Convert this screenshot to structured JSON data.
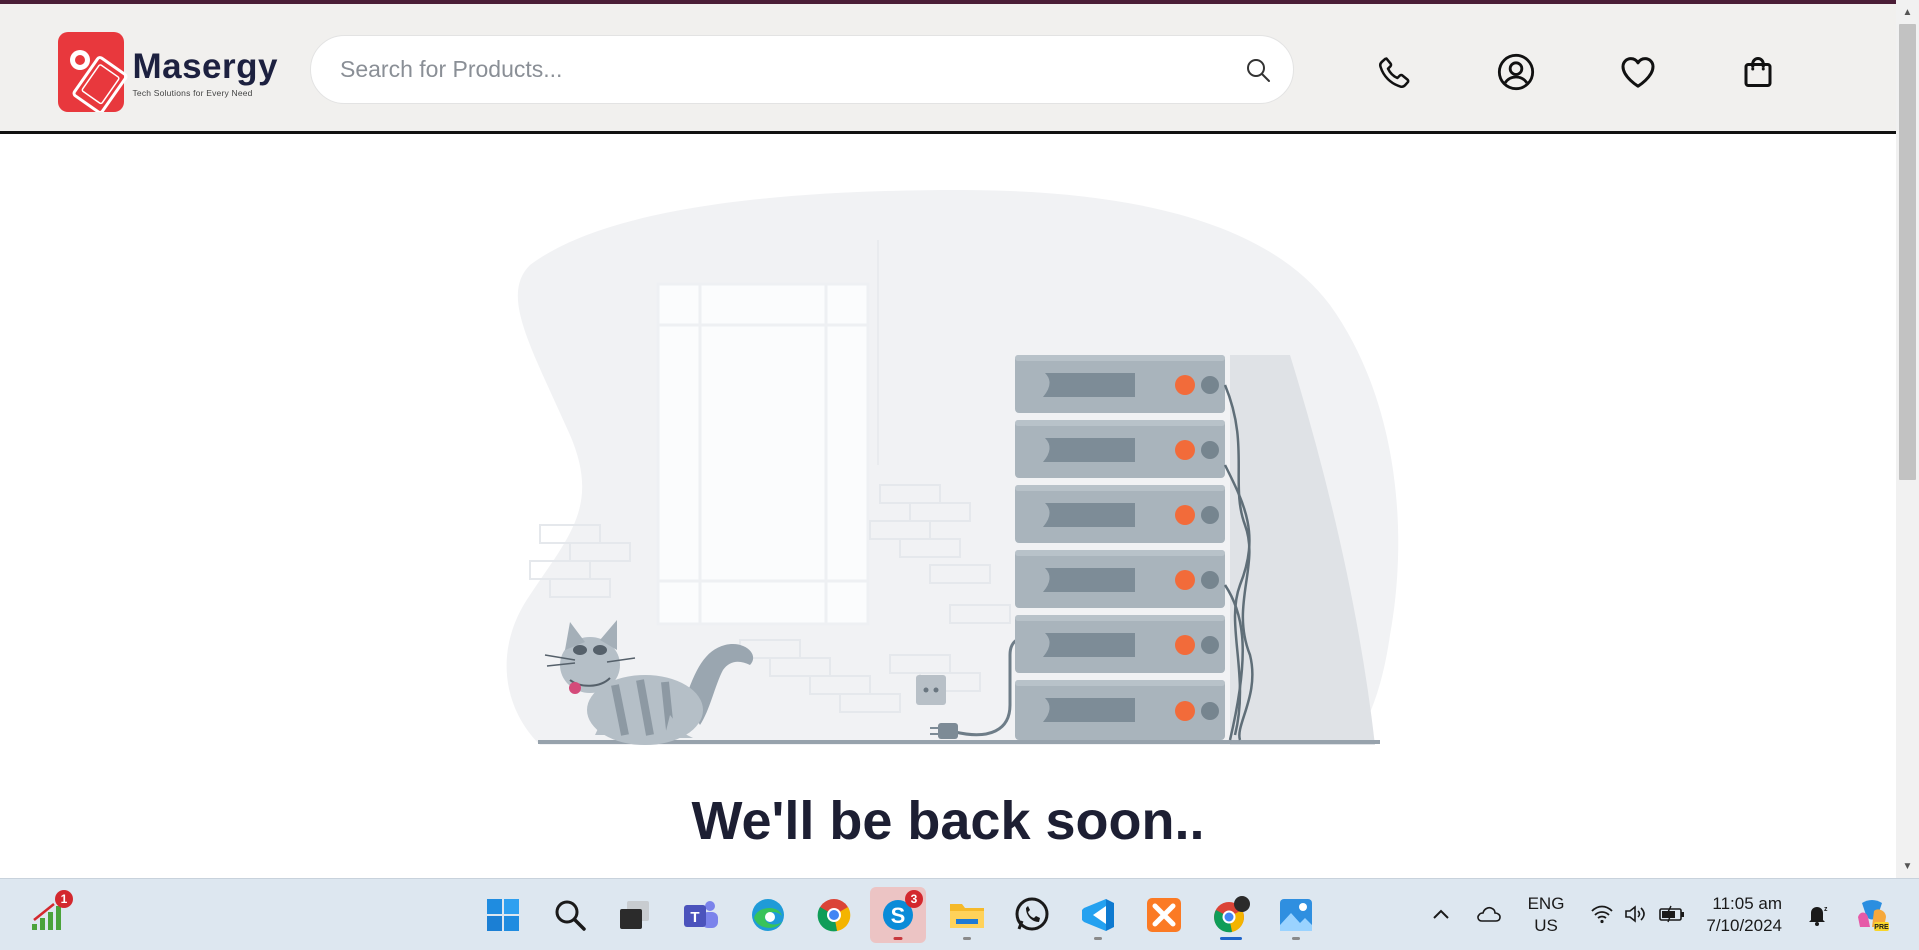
{
  "header": {
    "brand_name": "Masergy",
    "brand_tagline": "Tech Solutions for Every Need",
    "search_placeholder": "Search for Products...",
    "icons": [
      "phone-icon",
      "account-icon",
      "heart-icon",
      "shopping-bag-icon"
    ]
  },
  "main": {
    "heading": "We'll be back soon.."
  },
  "colors": {
    "brand_red": "#e8383d",
    "header_bg": "#f1f0ee",
    "heading": "#1d1f33",
    "server_led": "#f26b3a",
    "taskbar_bg": "#dde7f0"
  },
  "taskbar": {
    "apps": [
      {
        "name": "network-status",
        "badge": "1"
      },
      {
        "name": "start"
      },
      {
        "name": "search"
      },
      {
        "name": "task-view"
      },
      {
        "name": "teams"
      },
      {
        "name": "edge"
      },
      {
        "name": "chrome"
      },
      {
        "name": "skype",
        "badge": "3",
        "active": true
      },
      {
        "name": "file-explorer"
      },
      {
        "name": "whatsapp"
      },
      {
        "name": "vscode"
      },
      {
        "name": "xampp"
      },
      {
        "name": "chrome-profile"
      },
      {
        "name": "photos"
      }
    ],
    "tray": {
      "language_line1": "ENG",
      "language_line2": "US",
      "time": "11:05 am",
      "date": "7/10/2024"
    }
  }
}
